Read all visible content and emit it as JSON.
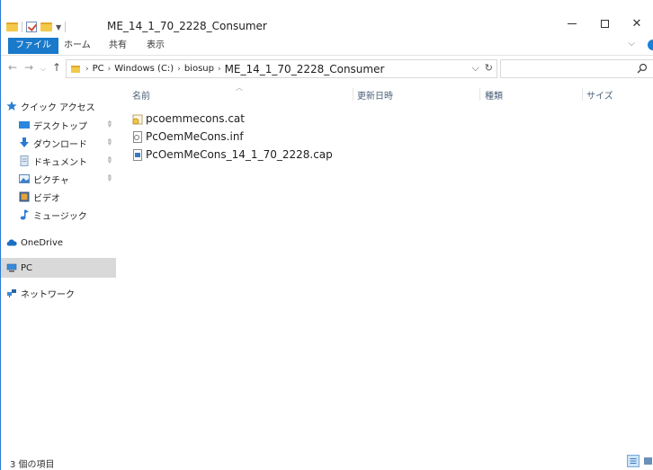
{
  "window": {
    "title": "ME_14_1_70_2228_Consumer",
    "controls": {
      "minimize": "—",
      "maximize": "☐",
      "close": "✕"
    }
  },
  "ribbon": {
    "tabs": [
      "ファイル",
      "ホーム",
      "共有",
      "表示"
    ],
    "expand": "⌵"
  },
  "address": {
    "crumbs": [
      "PC",
      "Windows (C:)",
      "biosup",
      "ME_14_1_70_2228_Consumer"
    ],
    "dropdown": "⌵",
    "refresh": "↻"
  },
  "search": {
    "placeholder": ""
  },
  "navpane": {
    "quick_access": "クイック アクセス",
    "desktop": "デスクトップ",
    "downloads": "ダウンロード",
    "documents": "ドキュメント",
    "pictures": "ピクチャ",
    "videos": "ビデオ",
    "music": "ミュージック",
    "onedrive": "OneDrive",
    "pc": "PC",
    "network": "ネットワーク"
  },
  "columns": {
    "name": "名前",
    "date": "更新日時",
    "type": "種類",
    "size": "サイズ"
  },
  "files": [
    {
      "name": "pcoemmecons.cat",
      "icon": "catalog-file-icon"
    },
    {
      "name": "PcOemMeCons.inf",
      "icon": "inf-file-icon"
    },
    {
      "name": "PcOemMeCons_14_1_70_2228.cap",
      "icon": "cap-file-icon"
    }
  ],
  "status": {
    "item_count": "3 個の項目"
  },
  "colors": {
    "accent": "#1979ca",
    "folder": "#f3c94a",
    "selected": "#d9d9d9"
  }
}
